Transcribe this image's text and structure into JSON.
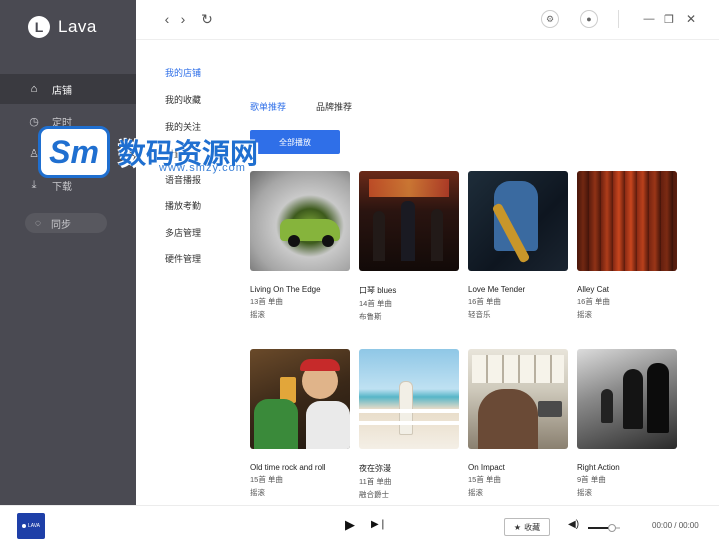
{
  "app": {
    "logo_letter": "L",
    "name": "Lava"
  },
  "sidebar": {
    "items": [
      {
        "icon": "store-icon",
        "glyph": "⌂",
        "label": "店铺"
      },
      {
        "icon": "clock-icon",
        "glyph": "◷",
        "label": "定时"
      },
      {
        "icon": "user-icon",
        "glyph": "♙",
        "label": "我的"
      },
      {
        "icon": "download-icon",
        "glyph": "⤓",
        "label": "下载"
      }
    ],
    "sync": {
      "glyph": "◌",
      "label": "同步"
    }
  },
  "watermark": {
    "logo": "Sm",
    "text": "数码资源网",
    "url": "www.smzy.com"
  },
  "topbar": {
    "back": "‹",
    "forward": "›",
    "refresh": "↻",
    "settings": "⚙",
    "account": "●",
    "minimize": "—",
    "maximize": "❐",
    "close": "✕"
  },
  "subnav": [
    "我的店铺",
    "我的收藏",
    "我的关注",
    "设置",
    "语音播报",
    "播放考勤",
    "多店管理",
    "硬件管理"
  ],
  "tabs": [
    "歌单推荐",
    "品牌推荐"
  ],
  "play_all": "全部播放",
  "playlists": [
    {
      "title": "Living On The Edge",
      "count": "13首 单曲",
      "genre": "摇滚"
    },
    {
      "title": "口琴 blues",
      "count": "14首 单曲",
      "genre": "布鲁斯"
    },
    {
      "title": "Love Me Tender",
      "count": "16首 单曲",
      "genre": "轻音乐"
    },
    {
      "title": "Alley Cat",
      "count": "16首 单曲",
      "genre": "摇滚"
    },
    {
      "title": "Old time rock and roll",
      "count": "15首 单曲",
      "genre": "摇滚"
    },
    {
      "title": "夜在弥漫",
      "count": "11首 单曲",
      "genre": "融合爵士"
    },
    {
      "title": "On Impact",
      "count": "15首 单曲",
      "genre": "摇滚"
    },
    {
      "title": "Right Action",
      "count": "9首 单曲",
      "genre": "摇滚"
    }
  ],
  "player": {
    "cover_label": "LAVA",
    "play": "▶",
    "next": "▶❘",
    "favorite_icon": "★",
    "favorite_label": "收藏",
    "volume_icon": "◀)",
    "volume_level": 0.75,
    "time": "00:00 / 00:00"
  }
}
